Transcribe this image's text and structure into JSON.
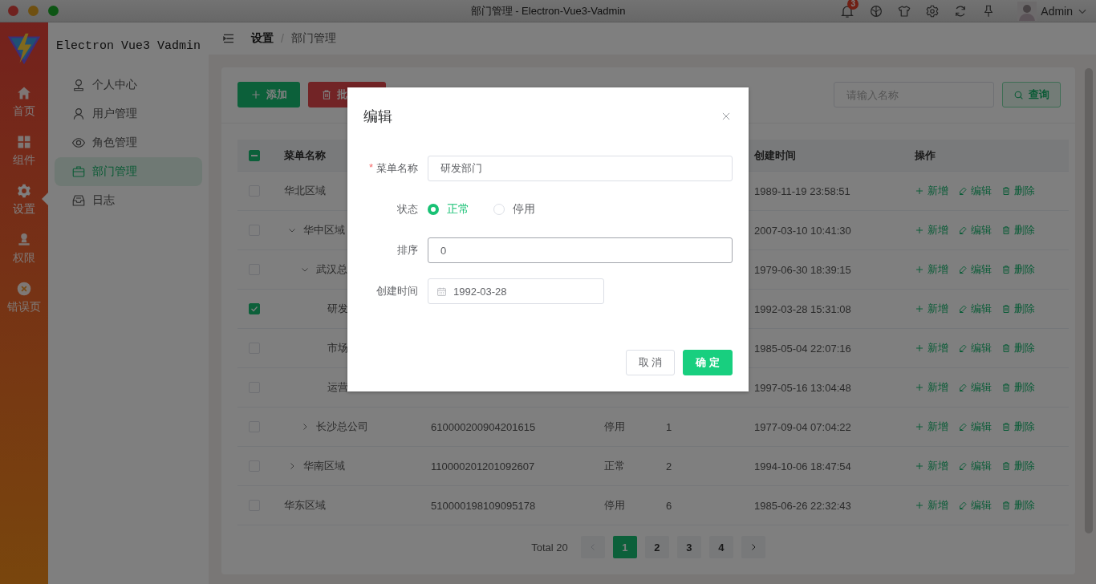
{
  "window": {
    "title": "部门管理 - Electron-Vue3-Vadmin"
  },
  "header_tools": {
    "notification_count": "3",
    "user": "Admin"
  },
  "rail": {
    "items": [
      {
        "label": "首页",
        "selected": false
      },
      {
        "label": "组件",
        "selected": false
      },
      {
        "label": "设置",
        "selected": true
      },
      {
        "label": "权限",
        "selected": false
      },
      {
        "label": "错误页",
        "selected": false
      }
    ]
  },
  "sidebar": {
    "brand": "Electron Vue3 Vadmin",
    "items": [
      {
        "label": "个人中心",
        "selected": false
      },
      {
        "label": "用户管理",
        "selected": false
      },
      {
        "label": "角色管理",
        "selected": false
      },
      {
        "label": "部门管理",
        "selected": true
      },
      {
        "label": "日志",
        "selected": false
      }
    ]
  },
  "breadcrumb_separator": "/",
  "breadcrumb": [
    {
      "label": "设置",
      "current": false
    },
    {
      "label": "部门管理",
      "current": true
    }
  ],
  "toolbar": {
    "add_button": "添加",
    "delete_button": "批",
    "search": {
      "placeholder": "请输入名称"
    },
    "search_button": "查询"
  },
  "table": {
    "select_all": {
      "indeterminate": true
    },
    "columns": [
      {
        "label": "菜单名称"
      },
      {
        "label": "创建时间"
      },
      {
        "label": "操作"
      }
    ],
    "rows": [
      {
        "checked": false,
        "name": "华北区域",
        "created": "1989-11-19 23:58:51",
        "actions": [
          "新增",
          "编辑",
          "删除"
        ]
      },
      {
        "checked": false,
        "name": "华中区域",
        "expanded": true,
        "created": "2007-03-10 10:41:30",
        "actions": [
          "新增",
          "编辑",
          "删除"
        ],
        "children": [
          {
            "checked": false,
            "name": "武汉总",
            "expanded": true,
            "created": "1979-06-30 18:39:15",
            "actions": [
              "新增",
              "编辑",
              "删除"
            ],
            "children": [
              {
                "checked": true,
                "name": "研发",
                "created": "1992-03-28 15:31:08",
                "actions": [
                  "新增",
                  "编辑",
                  "删除"
                ]
              },
              {
                "checked": false,
                "name": "市场",
                "created": "1985-05-04 22:07:16",
                "actions": [
                  "新增",
                  "编辑",
                  "删除"
                ]
              },
              {
                "checked": false,
                "name": "运营",
                "created": "1997-05-16 13:04:48",
                "actions": [
                  "新增",
                  "编辑",
                  "删除"
                ]
              }
            ]
          },
          {
            "checked": false,
            "name": "长沙总公司",
            "expanded": false,
            "code": "610000200904201615",
            "status": "停用",
            "sort": "1",
            "created": "1977-09-04 07:04:22",
            "actions": [
              "新增",
              "编辑",
              "删除"
            ]
          }
        ]
      },
      {
        "checked": false,
        "name": "华南区域",
        "expanded": false,
        "code": "110000201201092607",
        "status": "正常",
        "sort": "2",
        "created": "1994-10-06 18:47:54",
        "actions": [
          "新增",
          "编辑",
          "删除"
        ]
      },
      {
        "checked": false,
        "name": "华东区域",
        "code": "510000198109095178",
        "status": "停用",
        "sort": "6",
        "created": "1985-06-26 22:32:43",
        "actions": [
          "新增",
          "编辑",
          "删除"
        ]
      }
    ]
  },
  "pagination": {
    "total": "Total 20",
    "prev": {
      "disabled": true
    },
    "next": {
      "disabled": false
    },
    "pages": [
      {
        "label": "1",
        "selected": true
      },
      {
        "label": "2",
        "selected": false
      },
      {
        "label": "3",
        "selected": false
      },
      {
        "label": "4",
        "selected": false
      }
    ]
  },
  "dialog": {
    "title": "编辑",
    "required_mark": "*",
    "fields": [
      {
        "kind": "text",
        "label": "菜单名称",
        "required": true,
        "value": "研发部门",
        "focused": false
      },
      {
        "kind": "radio",
        "label": "状态",
        "required": false,
        "options": [
          {
            "label": "正常",
            "selected": true
          },
          {
            "label": "停用",
            "selected": false
          }
        ]
      },
      {
        "kind": "text",
        "label": "排序",
        "required": false,
        "value": "0",
        "focused": true
      },
      {
        "kind": "date",
        "label": "创建时间",
        "required": false,
        "value": "1992-03-28"
      }
    ],
    "buttons": [
      {
        "label": "取 消",
        "kind": "default"
      },
      {
        "label": "确 定",
        "kind": "primary"
      }
    ]
  }
}
